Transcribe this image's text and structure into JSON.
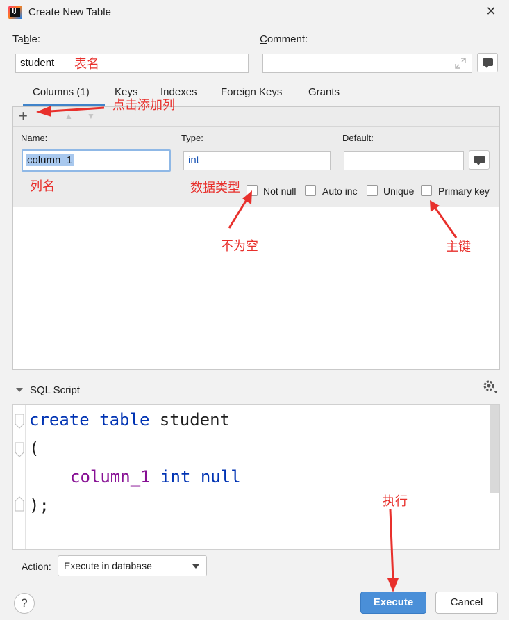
{
  "window": {
    "title": "Create New Table",
    "close_glyph": "✕",
    "app_icon_letters": "IJ"
  },
  "table": {
    "label": "Table:",
    "value": "student"
  },
  "comment": {
    "label": "Comment:",
    "value": "",
    "expand_icon": "expand-icon",
    "bubble_icon": "comment-bubble-icon"
  },
  "tabs": [
    "Columns (1)",
    "Keys",
    "Indexes",
    "Foreign Keys",
    "Grants"
  ],
  "toolbar": {
    "add": "+",
    "remove": "−",
    "up": "▲",
    "down": "▼"
  },
  "column": {
    "name_label": "Name:",
    "name_value": "column_1",
    "type_label": "Type:",
    "type_value": "int",
    "default_label": "Default:",
    "default_value": ""
  },
  "checkboxes": [
    {
      "label": "Not null",
      "checked": false
    },
    {
      "label": "Auto inc",
      "checked": false
    },
    {
      "label": "Unique",
      "checked": false
    },
    {
      "label": "Primary key",
      "checked": false
    }
  ],
  "sql": {
    "header": "SQL Script",
    "line1_kw": "create table",
    "line1_id": "student",
    "line2": "(",
    "line3_id": "column_1",
    "line3_kw": "int null",
    "line4": ");"
  },
  "action": {
    "label": "Action:",
    "value": "Execute in database"
  },
  "buttons": {
    "help": "?",
    "execute": "Execute",
    "cancel": "Cancel"
  },
  "annotations": {
    "table_name": "表名",
    "add_column": "点击添加列",
    "column_name": "列名",
    "data_type": "数据类型",
    "not_null": "不为空",
    "primary_key": "主键",
    "execute": "执行"
  },
  "colors": {
    "accent": "#4083c9",
    "execute_btn": "#4a8fd8",
    "annotation": "#e8302c",
    "keyword": "#0033b3",
    "identifier": "#871094"
  }
}
